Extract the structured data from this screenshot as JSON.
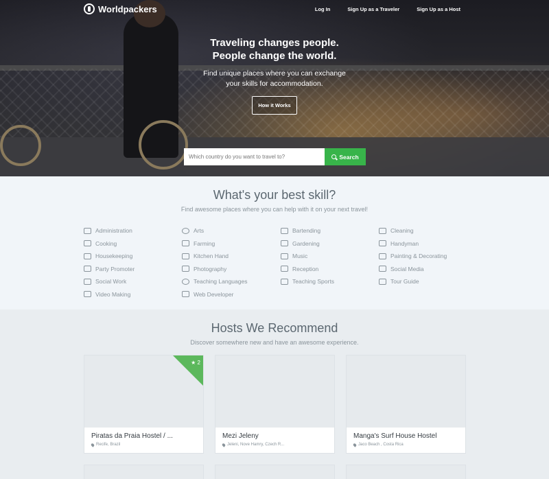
{
  "brand": {
    "name": "Worldpackers"
  },
  "nav": {
    "login": "Log In",
    "signup_traveler": "Sign Up as a Traveler",
    "signup_host": "Sign Up as a Host"
  },
  "hero": {
    "title_line1": "Traveling changes people.",
    "title_line2": "People change the world.",
    "sub_line1": "Find unique places where you can exchange",
    "sub_line2": "your skills for accommodation.",
    "how_button": "How it Works",
    "search_placeholder": "Which country do you want to travel to?",
    "search_button": "Search"
  },
  "skills": {
    "title": "What's your best skill?",
    "subtitle": "Find awesome places where you can help with it on your next travel!",
    "columns": [
      [
        "Administration",
        "Cooking",
        "Housekeeping",
        "Party Promoter",
        "Social Work",
        "Video Making"
      ],
      [
        "Arts",
        "Farming",
        "Kitchen Hand",
        "Photography",
        "Teaching Languages",
        "Web Developer"
      ],
      [
        "Bartending",
        "Gardening",
        "Music",
        "Reception",
        "Teaching Sports"
      ],
      [
        "Cleaning",
        "Handyman",
        "Painting & Decorating",
        "Social Media",
        "Tour Guide"
      ]
    ]
  },
  "hosts": {
    "title": "Hosts We Recommend",
    "subtitle": "Discover somewhere new and have an awesome experience.",
    "cards": [
      {
        "name": "Piratas da Praia Hostel / ...",
        "location": "Recife, Brazil",
        "badge": "★ 2"
      },
      {
        "name": "Mezi Jeleny",
        "location": "Jeleni, Nove Hamry, Czech R..."
      },
      {
        "name": "Manga's Surf House Hostel",
        "location": "Jaco Beach , Costa Rica"
      }
    ]
  },
  "colors": {
    "accent": "#38b44a",
    "ribbon": "#5cb85c"
  }
}
